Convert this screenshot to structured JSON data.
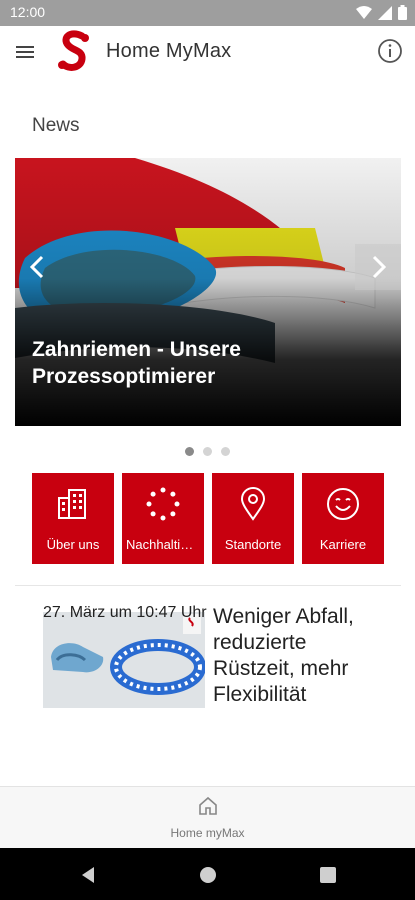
{
  "status_bar": {
    "time": "12:00"
  },
  "app_bar": {
    "title": "Home MyMax"
  },
  "news": {
    "title": "News",
    "slide_caption": "Zahnriemen - Unsere Prozessoptimierer",
    "dots_total": 3,
    "active_dot": 0
  },
  "tiles": [
    {
      "label": "Über uns",
      "icon": "building-icon"
    },
    {
      "label": "Nachhaltigkeit",
      "icon": "circle-dots-icon"
    },
    {
      "label": "Standorte",
      "icon": "location-pin-icon"
    },
    {
      "label": "Karriere",
      "icon": "smiley-icon"
    }
  ],
  "article": {
    "headline": "Weniger Abfall, reduzierte Rüstzeit, mehr Flexibilität",
    "date": "27. März um 10:47 Uhr"
  },
  "bottom_nav": {
    "home_label": "Home myMax"
  },
  "colors": {
    "brand_red": "#c8000f"
  }
}
